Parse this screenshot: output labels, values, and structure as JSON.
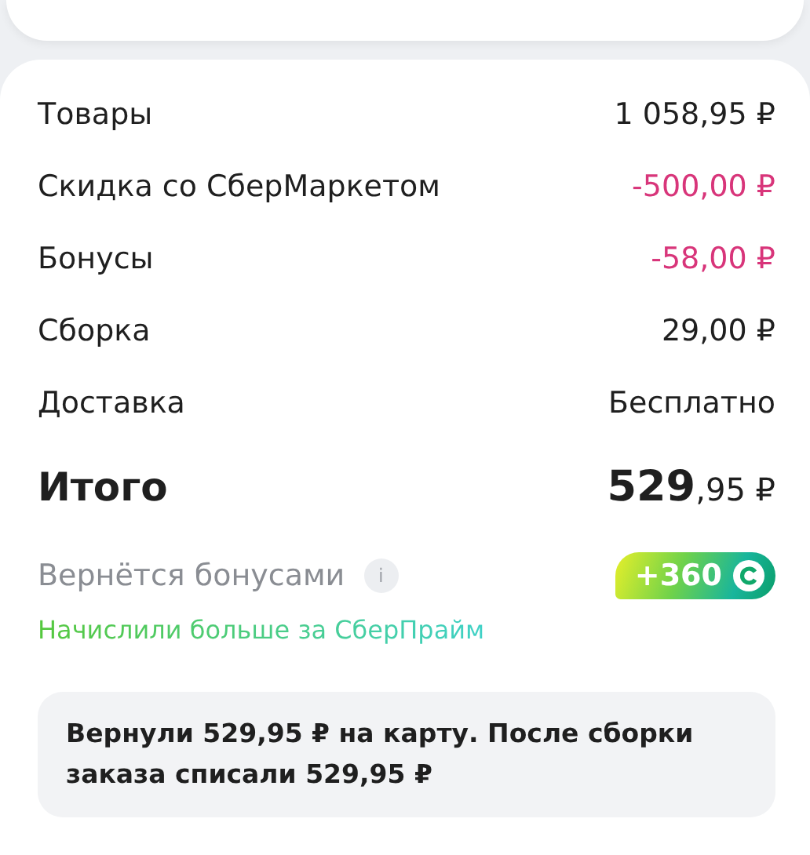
{
  "rows": [
    {
      "label": "Товары",
      "amount": "1 058,95 ₽",
      "kind": "normal"
    },
    {
      "label": "Скидка со СберМаркетом",
      "amount": "-500,00 ₽",
      "kind": "discount"
    },
    {
      "label": "Бонусы",
      "amount": "-58,00 ₽",
      "kind": "discount"
    },
    {
      "label": "Сборка",
      "amount": "29,00 ₽",
      "kind": "normal"
    },
    {
      "label": "Доставка",
      "amount": "Бесплатно",
      "kind": "normal"
    }
  ],
  "total": {
    "label": "Итого",
    "amount": "**529**,95 ₽"
  },
  "bonus": {
    "label": "Вернётся бонусами",
    "info": "i",
    "badge": "+360",
    "note": "Начислили больше за СберПрайм"
  },
  "notice": "Вернули 529,95 ₽ на карту. После сборки заказа списали 529,95 ₽"
}
